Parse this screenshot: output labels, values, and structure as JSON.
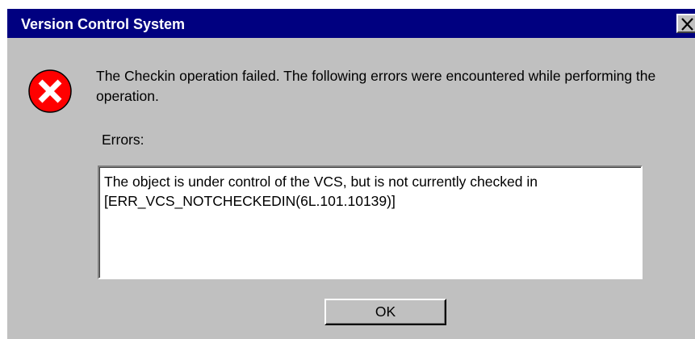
{
  "window": {
    "title": "Version Control System",
    "close_icon": "close-icon"
  },
  "dialog": {
    "icon": "error-icon",
    "message": "The Checkin operation failed. The following errors were encountered while performing the operation.",
    "errors_label": "Errors:",
    "errors_text_line1": "The object is under control of the VCS, but is not currently checked in",
    "errors_text_line2": "[ERR_VCS_NOTCHECKEDIN(6L.101.10139)]",
    "ok_label": "OK"
  },
  "colors": {
    "titlebar": "#000080",
    "dialog_bg": "#c0c0c0",
    "error_red": "#ff0000"
  }
}
